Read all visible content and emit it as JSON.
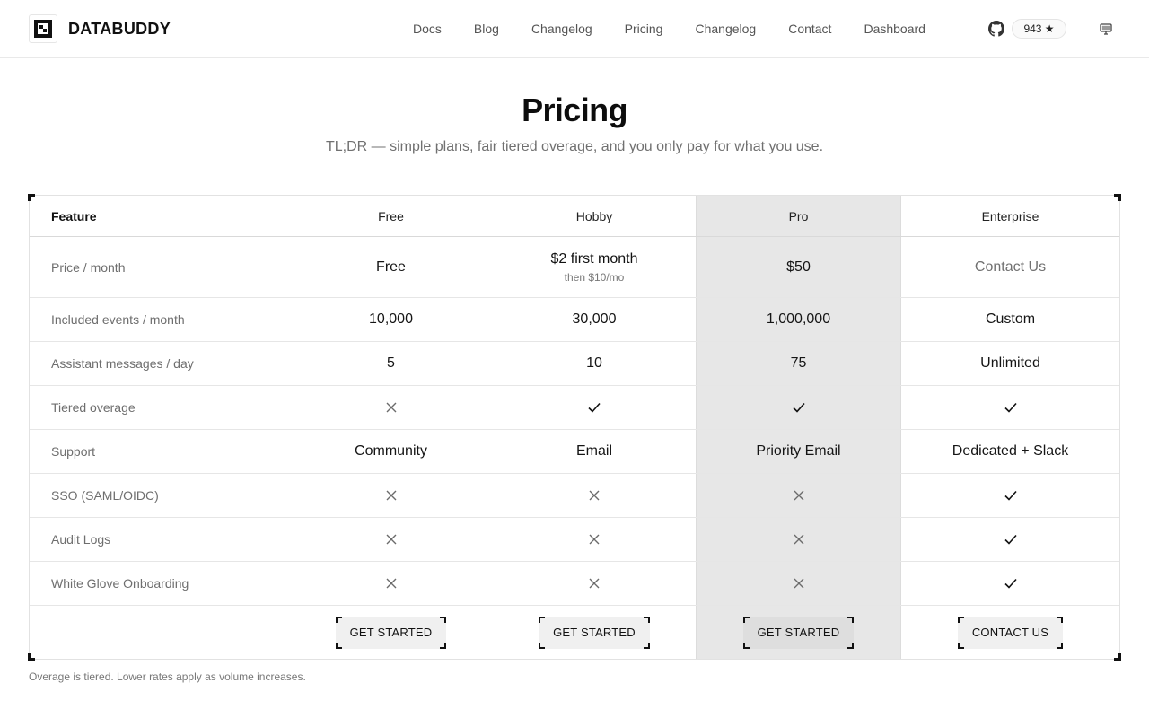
{
  "brand": {
    "name": "DATABUDDY"
  },
  "nav": {
    "items": [
      "Docs",
      "Blog",
      "Changelog",
      "Pricing",
      "Changelog",
      "Contact",
      "Dashboard"
    ],
    "github_stars": "943 ★"
  },
  "page": {
    "title": "Pricing",
    "subtitle": "TL;DR — simple plans, fair tiered overage, and you only pay for what you use."
  },
  "table": {
    "headers": [
      "Feature",
      "Free",
      "Hobby",
      "Pro",
      "Enterprise"
    ],
    "price_row": {
      "label": "Price / month",
      "free": "Free",
      "hobby_main": "$2 first month",
      "hobby_sub": "then $10/mo",
      "pro": "$50",
      "enterprise": "Contact Us"
    },
    "rows": [
      {
        "label": "Included events / month",
        "values": [
          "10,000",
          "30,000",
          "1,000,000",
          "Custom"
        ]
      },
      {
        "label": "Assistant messages / day",
        "values": [
          "5",
          "10",
          "75",
          "Unlimited"
        ]
      },
      {
        "label": "Tiered overage",
        "icons": [
          "x-icon",
          "check-icon",
          "check-icon",
          "check-icon"
        ]
      },
      {
        "label": "Support",
        "values": [
          "Community",
          "Email",
          "Priority Email",
          "Dedicated + Slack"
        ]
      },
      {
        "label": "SSO (SAML/OIDC)",
        "icons": [
          "x-icon",
          "x-icon",
          "x-icon",
          "check-icon"
        ]
      },
      {
        "label": "Audit Logs",
        "icons": [
          "x-icon",
          "x-icon",
          "x-icon",
          "check-icon"
        ]
      },
      {
        "label": "White Glove Onboarding",
        "icons": [
          "x-icon",
          "x-icon",
          "x-icon",
          "check-icon"
        ]
      }
    ],
    "cta": [
      "GET STARTED",
      "GET STARTED",
      "GET STARTED",
      "CONTACT US"
    ]
  },
  "footnote": "Overage is tiered. Lower rates apply as volume increases.",
  "colors": {
    "pro_column": "#e7e7e7",
    "accent": "#111111",
    "muted_text": "#707070"
  }
}
